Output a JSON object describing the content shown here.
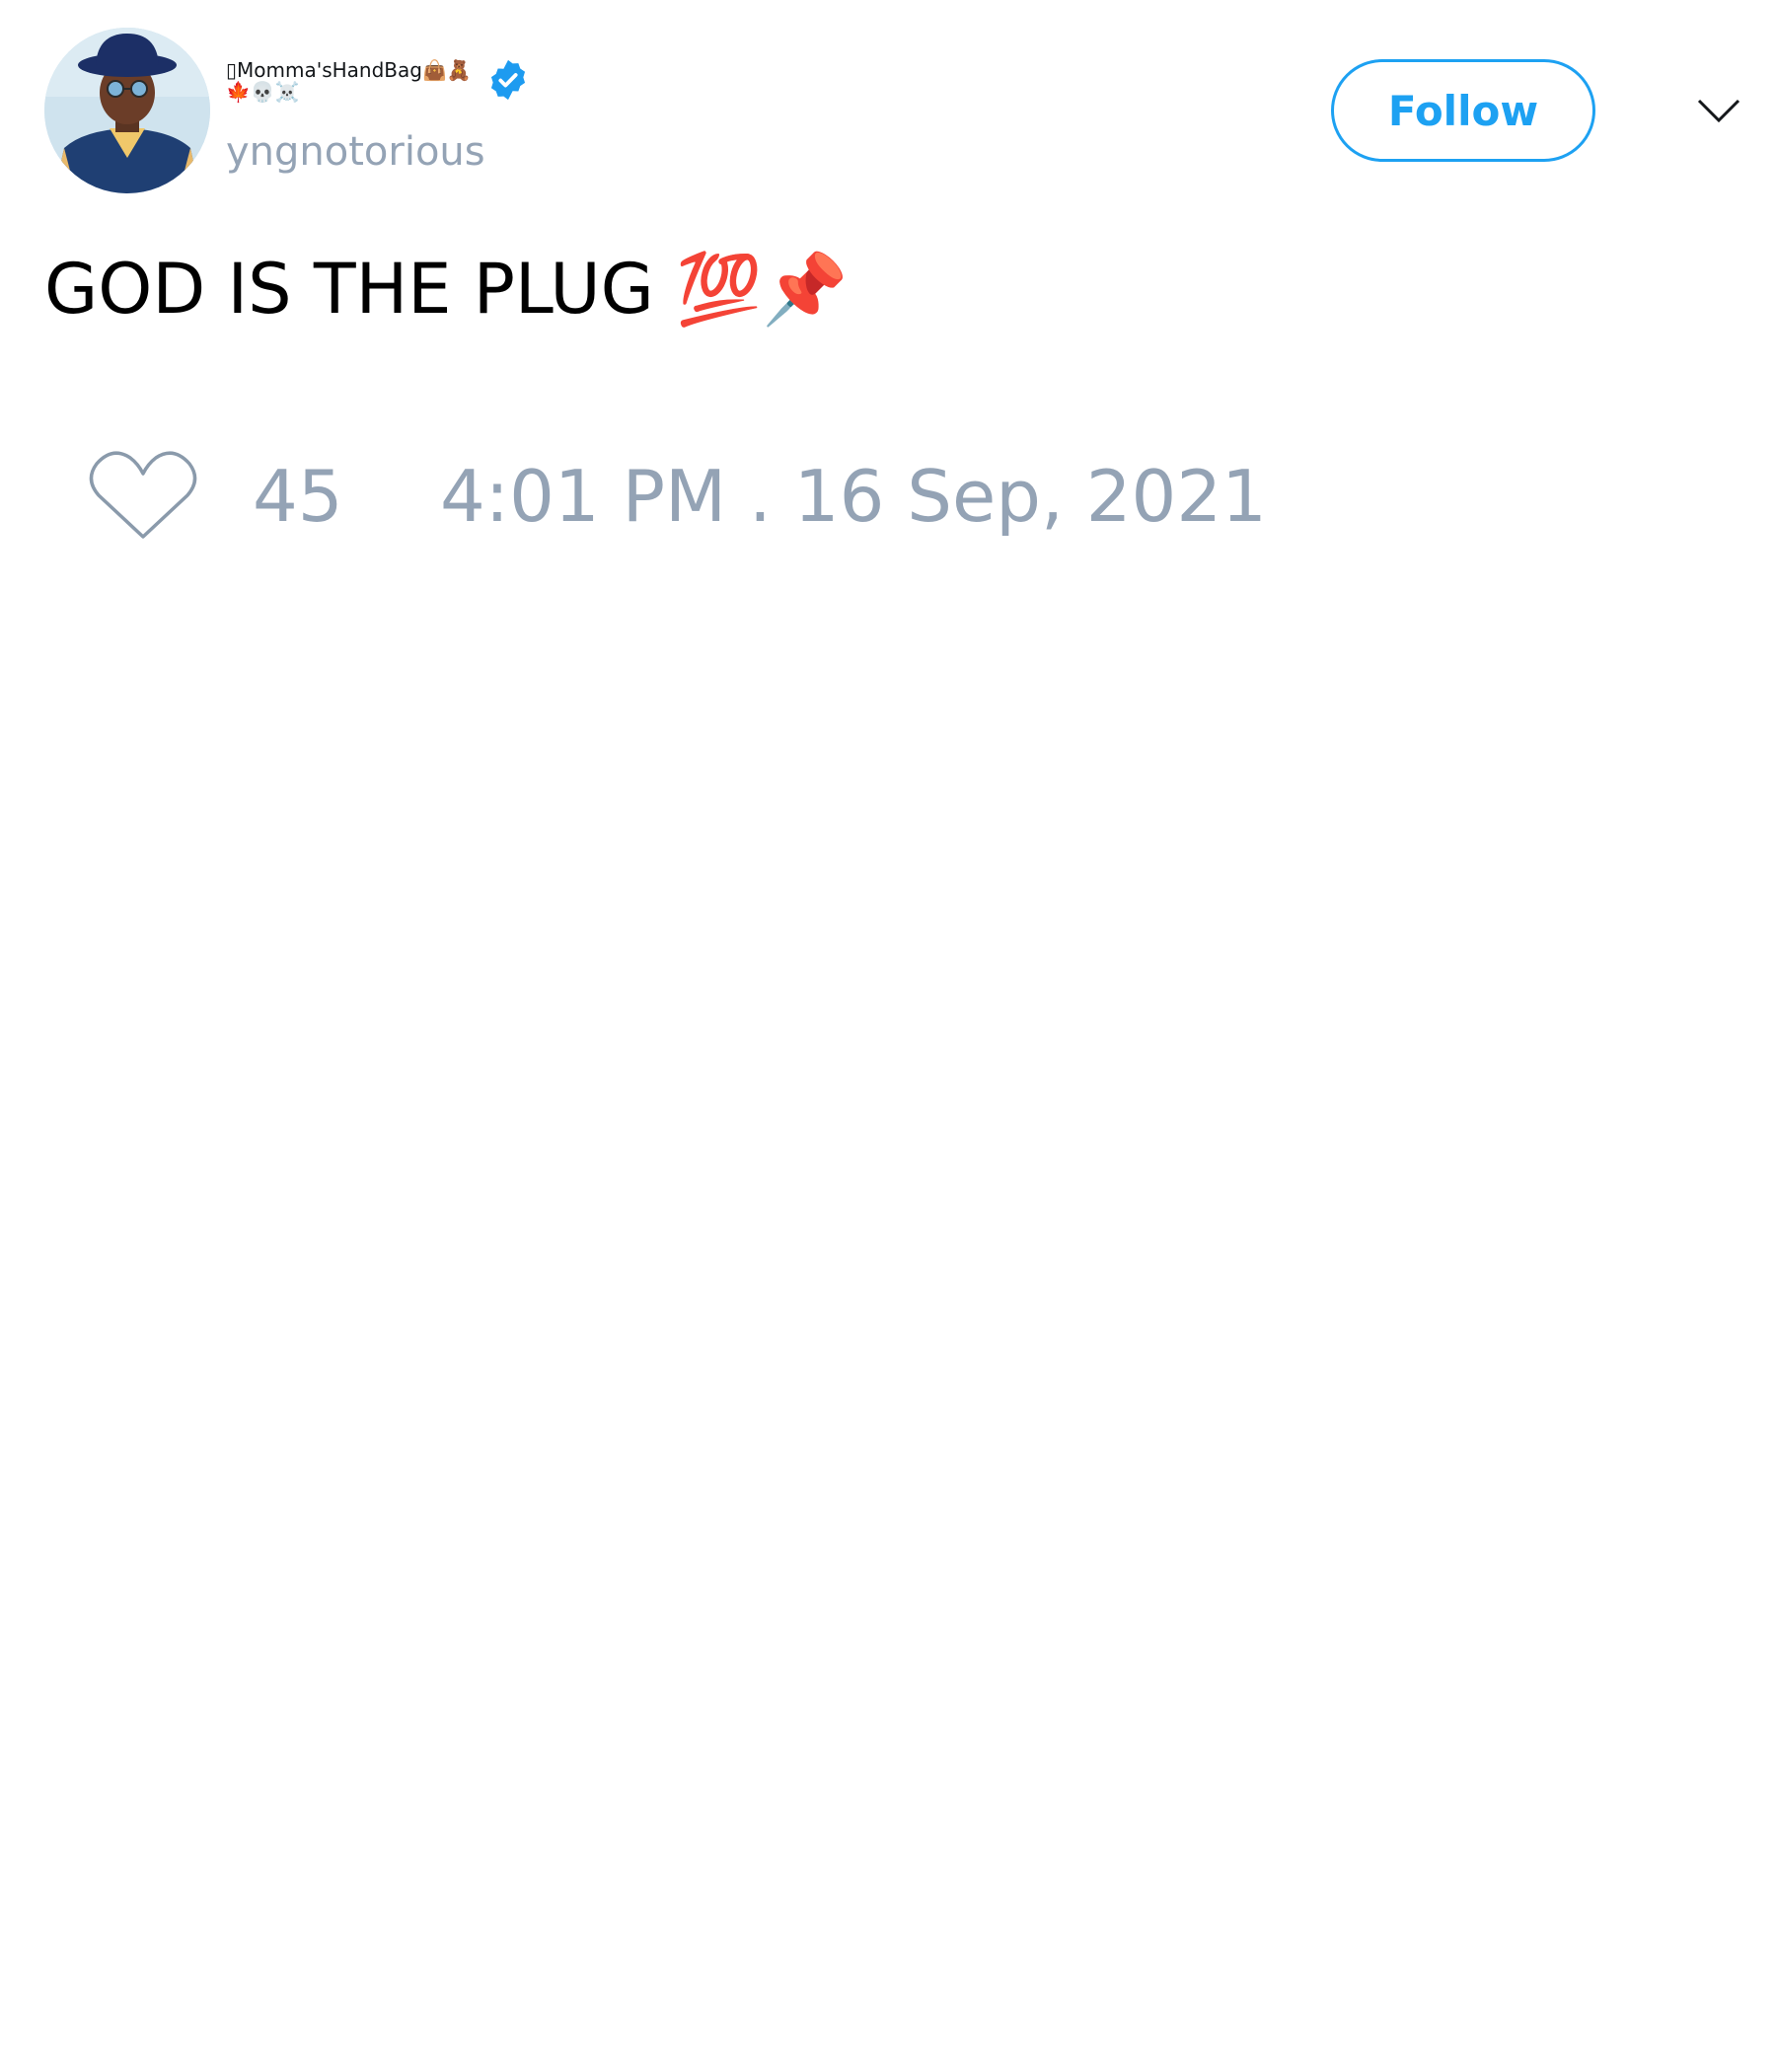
{
  "author": {
    "display_name": "▯Momma'sHandBag👜🧸🍁💀☠️",
    "handle": "yngnotorious",
    "verified": true,
    "avatar_icon": "user-avatar-photo"
  },
  "actions": {
    "follow_label": "Follow",
    "menu_icon": "chevron-down-icon"
  },
  "tweet": {
    "text": "GOD IS THE PLUG 💯📌"
  },
  "footer": {
    "like_icon": "heart-outline-icon",
    "like_count": "45",
    "timestamp": "4:01 PM . 16 Sep, 2021"
  },
  "colors": {
    "accent": "#1da1f2",
    "muted_text": "#94a3b5",
    "verified_badge": "#1d9bf0",
    "heart_outline": "#8a9aab"
  }
}
